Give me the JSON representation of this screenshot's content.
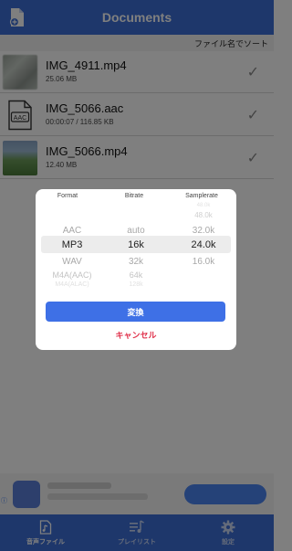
{
  "header": {
    "title": "Documents"
  },
  "sort": {
    "label": "ファイル名でソート"
  },
  "files": [
    {
      "name": "IMG_4911.mp4",
      "meta": "25.06 MB",
      "thumb": "video-thumbnail"
    },
    {
      "name": "IMG_5066.aac",
      "meta": "00:00:07 / 116.85 KB",
      "thumb": "aac-file-icon",
      "badge": "AAC"
    },
    {
      "name": "IMG_5066.mp4",
      "meta": "12.40 MB",
      "thumb": "video-thumbnail"
    }
  ],
  "dialog": {
    "columns": {
      "format": "Format",
      "bitrate": "Bitrate",
      "samplerate": "Samplerate"
    },
    "format_options": [
      "AAC",
      "MP3",
      "WAV",
      "M4A(AAC)",
      "M4A(ALAC)"
    ],
    "format_selected": "MP3",
    "bitrate_options": [
      "auto",
      "16k",
      "32k",
      "64k",
      "128k"
    ],
    "bitrate_selected": "16k",
    "samplerate_options": [
      "48.0k",
      "48.0k",
      "32.0k",
      "24.0k",
      "16.0k"
    ],
    "samplerate_selected": "24.0k",
    "convert_label": "変換",
    "cancel_label": "キャンセル"
  },
  "tabs": [
    {
      "label": "音声ファイル",
      "icon": "audio-file-icon",
      "active": true
    },
    {
      "label": "プレイリスト",
      "icon": "playlist-icon",
      "active": false
    },
    {
      "label": "設定",
      "icon": "gear-icon",
      "active": false
    }
  ],
  "colors": {
    "brand": "#3d6fd6",
    "convert": "#3e70e6",
    "cancel": "#e0304a"
  }
}
